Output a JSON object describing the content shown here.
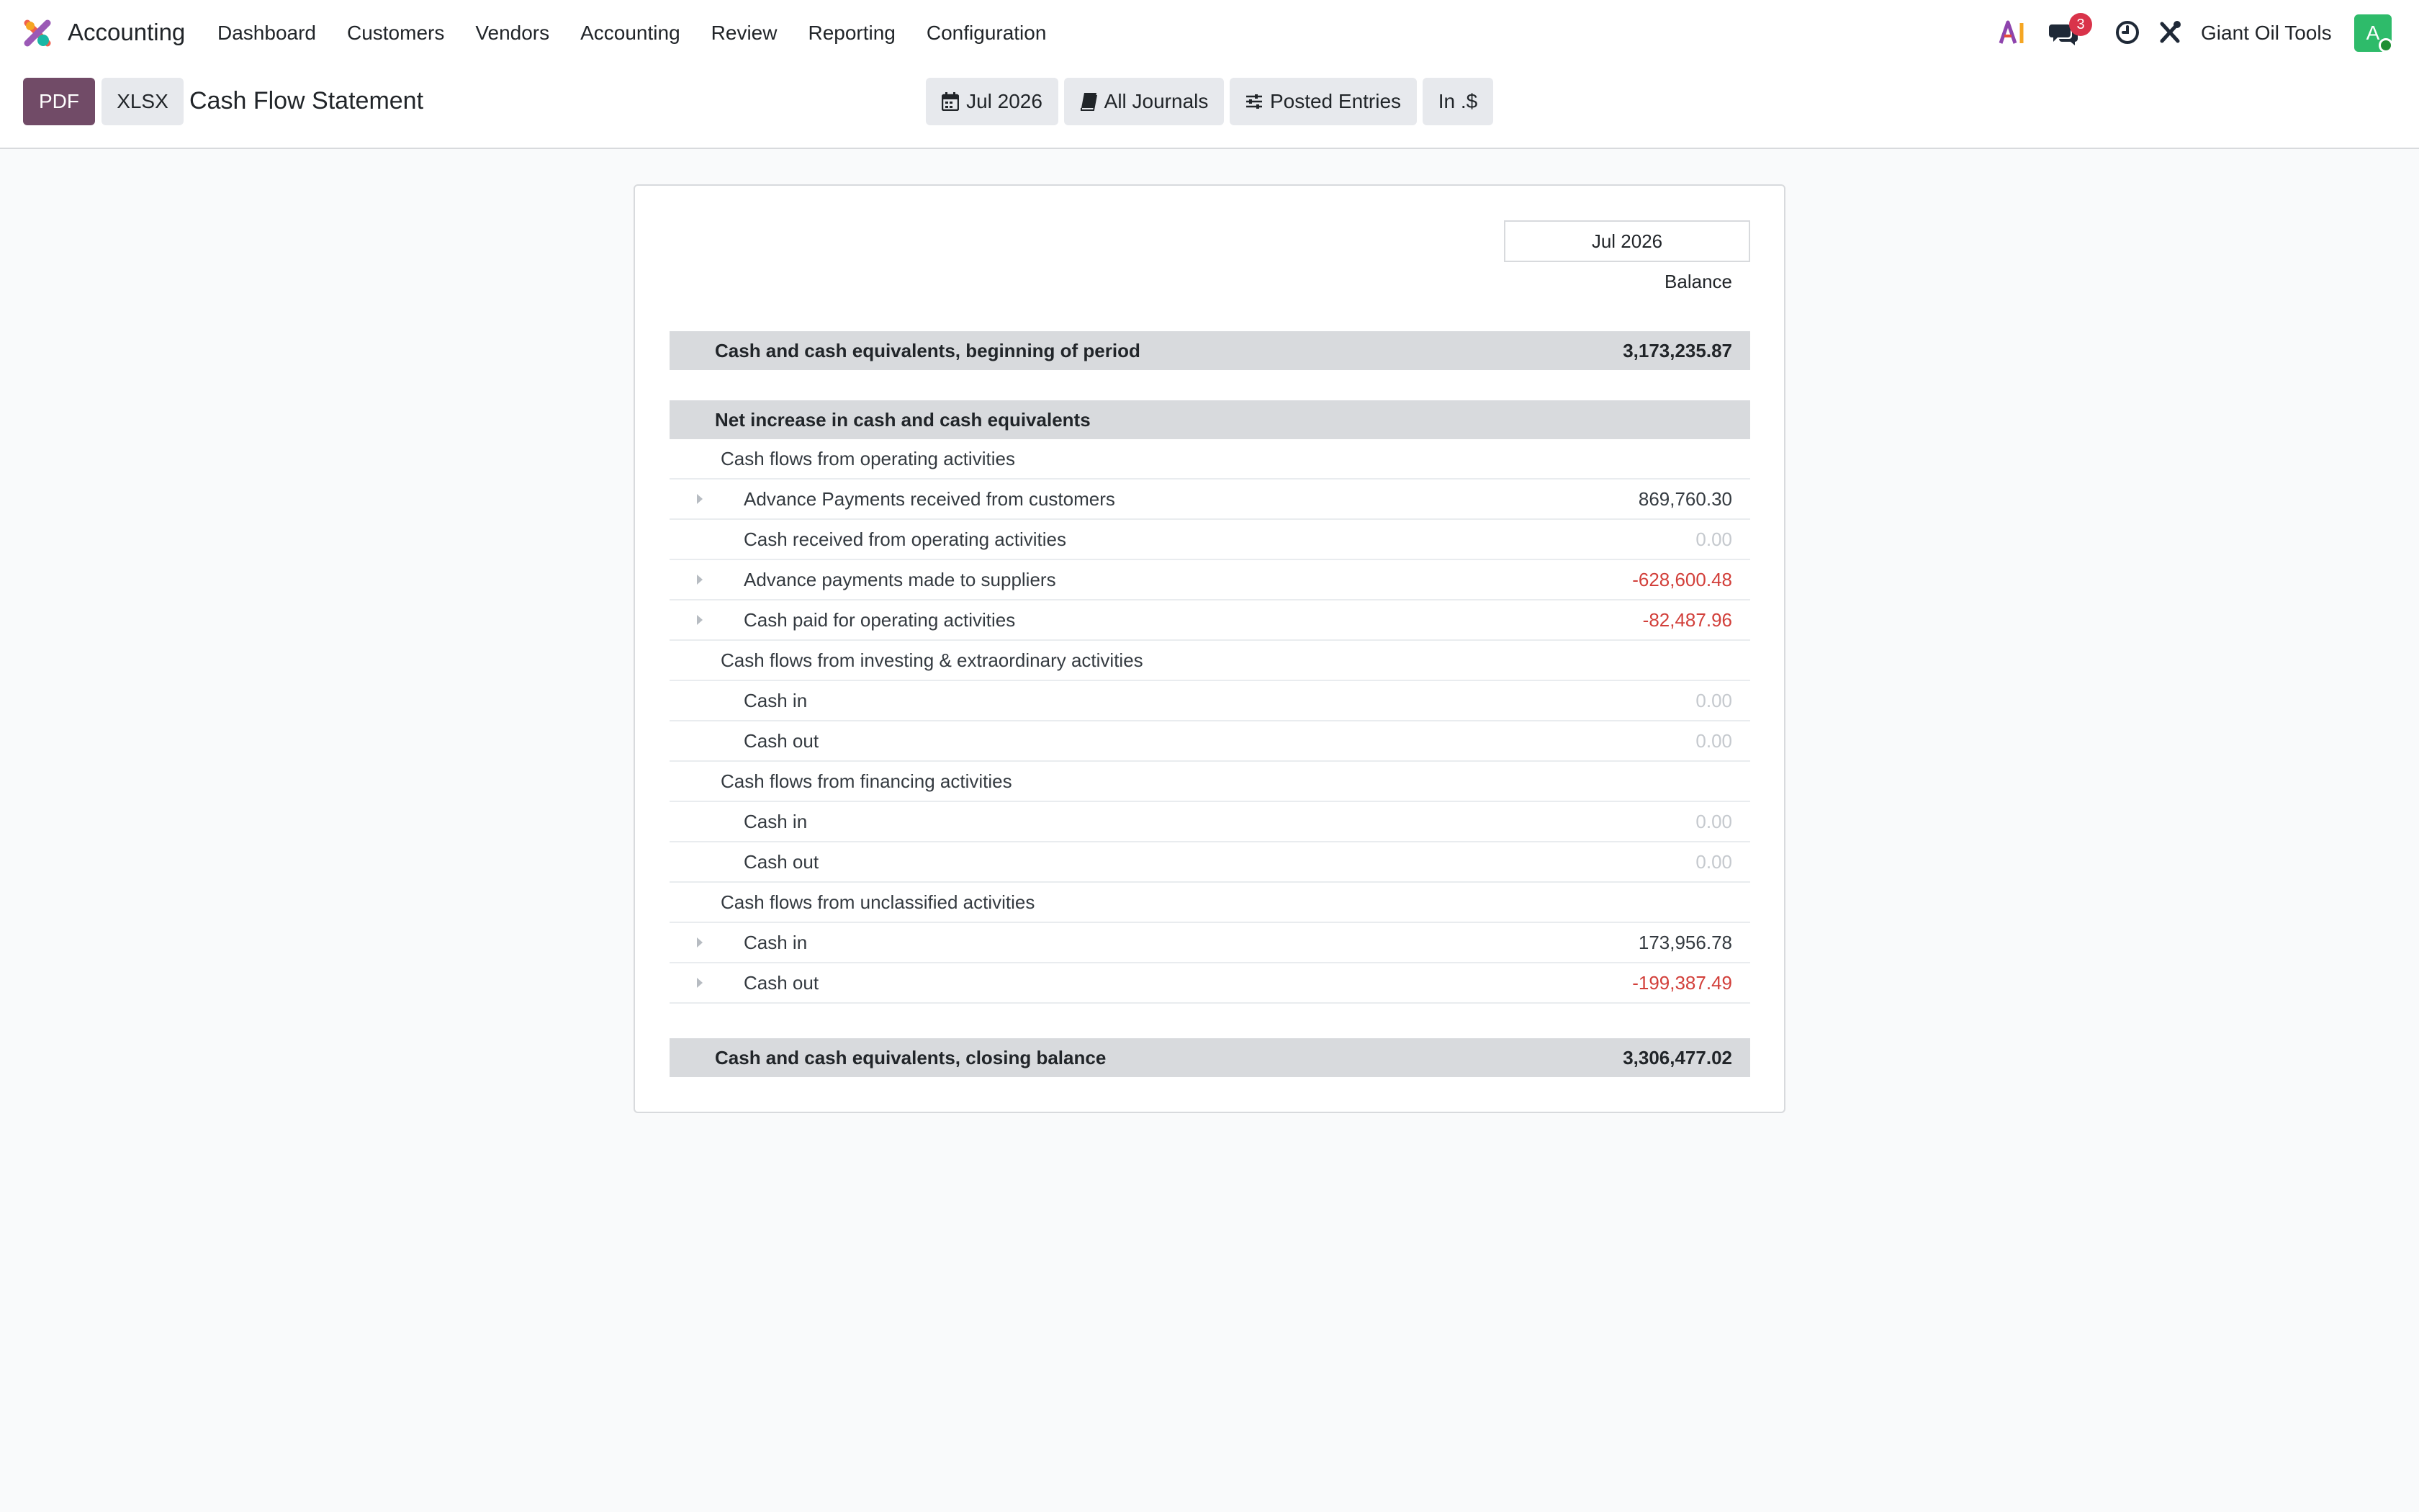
{
  "navbar": {
    "app_name": "Accounting",
    "menu": [
      "Dashboard",
      "Customers",
      "Vendors",
      "Accounting",
      "Review",
      "Reporting",
      "Configuration"
    ],
    "systray": {
      "ai_icon": "ai-icon",
      "messages_icon": "chat-icon",
      "messages_count": "3",
      "activity_icon": "clock-icon",
      "tools_icon": "tools-icon",
      "company": "Giant Oil Tools",
      "avatar_letter": "A"
    }
  },
  "control": {
    "pdf_label": "PDF",
    "xlsx_label": "XLSX",
    "title": "Cash Flow Statement",
    "filters": {
      "date": "Jul 2026",
      "journals": "All Journals",
      "entries": "Posted Entries",
      "currency": "In .$"
    }
  },
  "report": {
    "period": "Jul 2026",
    "column": "Balance",
    "beginning": {
      "label": "Cash and cash equivalents, beginning of period",
      "value": "3,173,235.87"
    },
    "net_increase": {
      "label": "Net increase in cash and cash equivalents"
    },
    "operating": {
      "label": "Cash flows from operating activities",
      "lines": [
        {
          "label": "Advance Payments received from customers",
          "value": "869,760.30"
        },
        {
          "label": "Cash received from operating activities",
          "value": "0.00"
        },
        {
          "label": "Advance payments made to suppliers",
          "value": "-628,600.48"
        },
        {
          "label": "Cash paid for operating activities",
          "value": "-82,487.96"
        }
      ]
    },
    "investing": {
      "label": "Cash flows from investing & extraordinary activities",
      "lines": [
        {
          "label": "Cash in",
          "value": "0.00"
        },
        {
          "label": "Cash out",
          "value": "0.00"
        }
      ]
    },
    "financing": {
      "label": "Cash flows from financing activities",
      "lines": [
        {
          "label": "Cash in",
          "value": "0.00"
        },
        {
          "label": "Cash out",
          "value": "0.00"
        }
      ]
    },
    "unclassified": {
      "label": "Cash flows from unclassified activities",
      "lines": [
        {
          "label": "Cash in",
          "value": "173,956.78"
        },
        {
          "label": "Cash out",
          "value": "-199,387.49"
        }
      ]
    },
    "closing": {
      "label": "Cash and cash equivalents, closing balance",
      "value": "3,306,477.02"
    }
  },
  "colors": {
    "brand": "#714b67",
    "negative": "#d23f3a",
    "zero": "#c5c9ce",
    "total_row": "#d8dadd"
  }
}
